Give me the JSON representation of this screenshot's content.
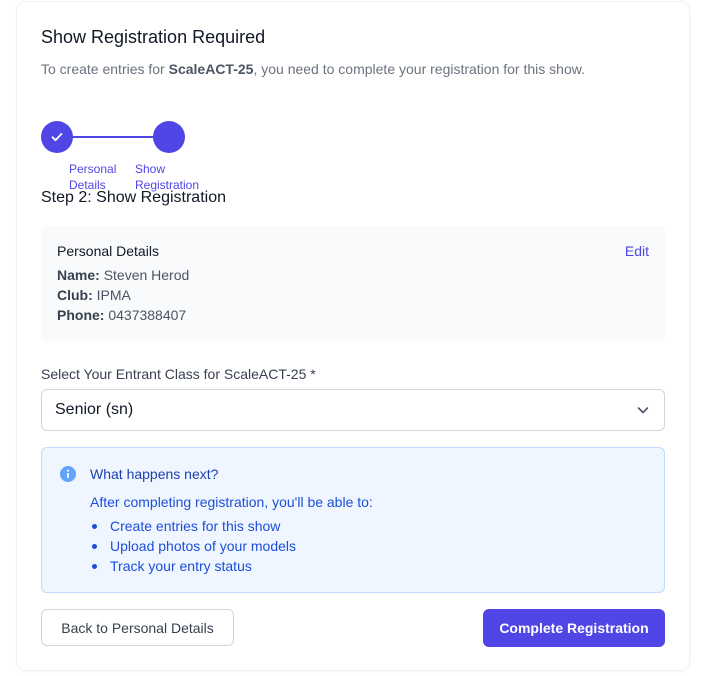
{
  "header": {
    "title": "Show Registration Required",
    "subtitle_before": "To create entries for ",
    "subtitle_show": "ScaleACT-25",
    "subtitle_after": ", you need to complete your registration for this show."
  },
  "stepper": {
    "steps": [
      {
        "label": "Personal Details",
        "status": "complete"
      },
      {
        "label": "Show Registration",
        "status": "current"
      }
    ],
    "current_heading": "Step 2: Show Registration"
  },
  "personal_details": {
    "title": "Personal Details",
    "edit_label": "Edit",
    "rows": [
      {
        "key": "Name:",
        "value": "Steven Herod"
      },
      {
        "key": "Club:",
        "value": "IPMA"
      },
      {
        "key": "Phone:",
        "value": "0437388407"
      }
    ]
  },
  "entrant_class": {
    "label": "Select Your Entrant Class for ScaleACT-25 *",
    "selected": "Senior (sn)"
  },
  "info": {
    "icon": "info-icon",
    "title": "What happens next?",
    "intro": "After completing registration, you'll be able to:",
    "items": [
      "Create entries for this show",
      "Upload photos of your models",
      "Track your entry status"
    ]
  },
  "actions": {
    "back_label": "Back to Personal Details",
    "complete_label": "Complete Registration"
  },
  "colors": {
    "primary": "#4f46e5",
    "info_bg": "#eff6ff",
    "info_text": "#1d4ed8"
  }
}
